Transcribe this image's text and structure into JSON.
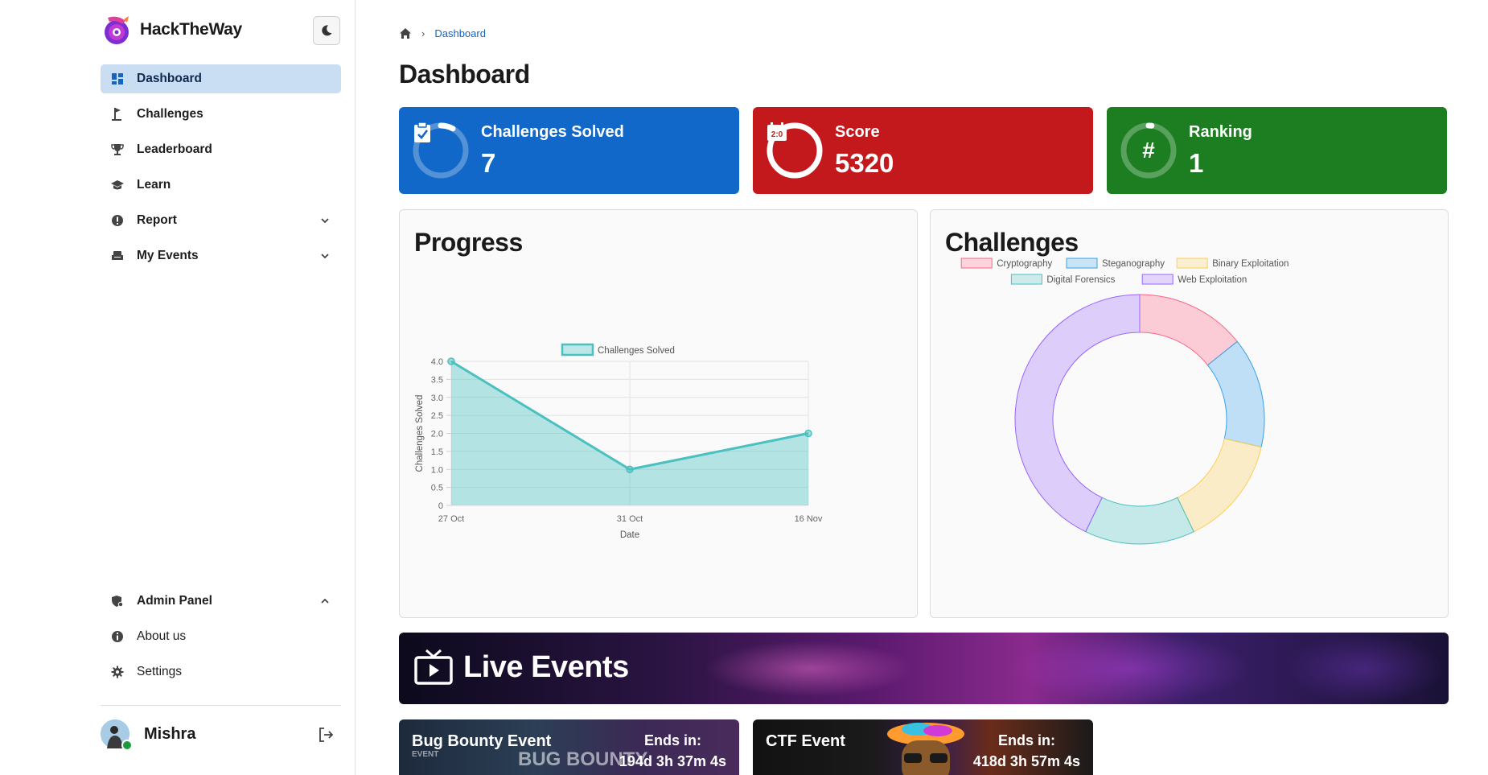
{
  "app": {
    "name": "HackTheWay"
  },
  "sidebar": {
    "items": [
      {
        "label": "Dashboard",
        "active": true
      },
      {
        "label": "Challenges"
      },
      {
        "label": "Leaderboard"
      },
      {
        "label": "Learn"
      },
      {
        "label": "Report"
      },
      {
        "label": "My Events"
      }
    ],
    "bottom_items": [
      {
        "label": "Admin Panel"
      },
      {
        "label": "About us"
      },
      {
        "label": "Settings"
      }
    ],
    "user": {
      "name": "Mishra",
      "status": "online"
    }
  },
  "breadcrumb": {
    "current": "Dashboard"
  },
  "page": {
    "title": "Dashboard"
  },
  "stats": [
    {
      "label": "Challenges Solved",
      "value": "7",
      "color": "#1268c9",
      "icon": "clipboard-check-icon",
      "progress": 0.08
    },
    {
      "label": "Score",
      "value": "5320",
      "color": "#c4191c",
      "icon": "calendar-timer-icon",
      "progress": 1.0
    },
    {
      "label": "Ranking",
      "value": "1",
      "color": "#1c7d21",
      "icon": "hash-icon",
      "progress": 0.02
    }
  ],
  "progress_card": {
    "title": "Progress"
  },
  "challenges_card": {
    "title": "Challenges"
  },
  "chart_data": [
    {
      "type": "area",
      "legend": [
        "Challenges Solved"
      ],
      "x": [
        "27 Oct",
        "31 Oct",
        "16 Nov"
      ],
      "series": [
        {
          "name": "Challenges Solved",
          "values": [
            4,
            1,
            2
          ],
          "color": "#4bc0c0"
        }
      ],
      "xlabel": "Date",
      "ylabel": "Challenges Solved",
      "ylim": [
        0,
        4
      ],
      "yticks": [
        "0",
        "0.5",
        "1.0",
        "1.5",
        "2.0",
        "2.5",
        "3.0",
        "3.5",
        "4.0"
      ],
      "grid": true,
      "legend_position": "top"
    },
    {
      "type": "pie",
      "variant": "doughnut",
      "categories": [
        "Cryptography",
        "Steganography",
        "Binary Exploitation",
        "Digital Forensics",
        "Web Exploitation"
      ],
      "values": [
        1,
        1,
        1,
        1,
        3
      ],
      "colors": [
        "#ff6384",
        "#36a2eb",
        "#ffce56",
        "#4bc0c0",
        "#9966ff"
      ],
      "legend_position": "top"
    }
  ],
  "live_events": {
    "title": "Live Events"
  },
  "events": [
    {
      "name": "Bug Bounty Event",
      "ends_label": "Ends in:",
      "ends_value": "194d 3h 37m 4s",
      "banner_text": "BUG BOUNTY",
      "banner_small": "EVENT"
    },
    {
      "name": "CTF Event",
      "ends_label": "Ends in:",
      "ends_value": "418d 3h 57m 4s"
    }
  ]
}
